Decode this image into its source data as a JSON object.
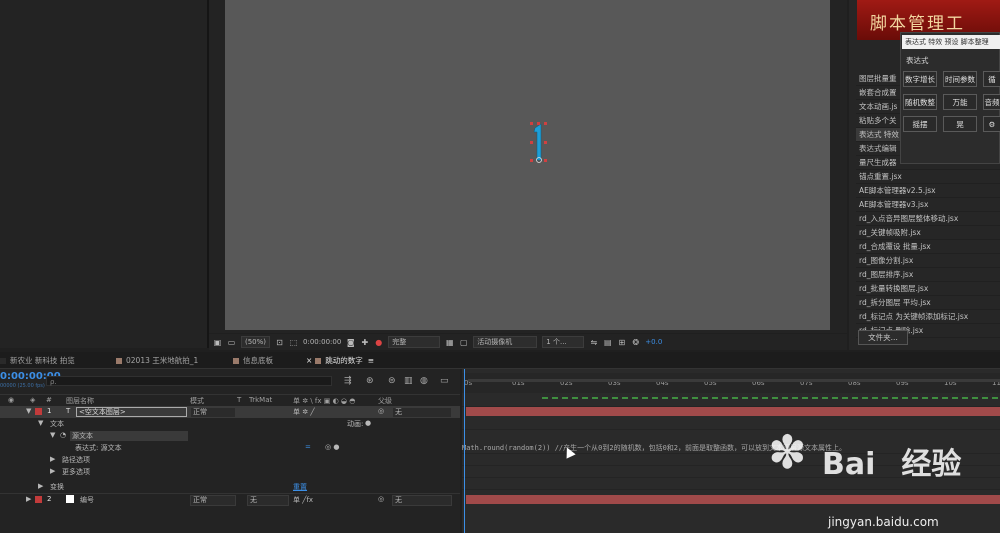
{
  "viewer_toolbar": {
    "zoom": "(50%)",
    "timecode": "0:00:00:00",
    "quality": "完整",
    "camera": "活动摄像机",
    "views": "1 个...",
    "exposure": "+0.0"
  },
  "script_panel": {
    "banner": "脚本管理工",
    "items": [
      "图层批量重",
      "嵌套合成置",
      "文本动画.js",
      "粘贴多个关",
      "表达式 特效",
      "表达式编辑",
      "量尺生成器",
      "锚点重置.jsx",
      "AE脚本管理器v2.5.jsx",
      "AE脚本管理器v3.jsx",
      "rd_入点音异图层整体移动.jsx",
      "rd_关键帧吸附.jsx",
      "rd_合成覆设 批量.jsx",
      "rd_图像分割.jsx",
      "rd_图层排序.jsx",
      "rd_批量转换图层.jsx",
      "rd_拆分图层 平均.jsx",
      "rd_标记点 为关键帧添加标记.jsx",
      "rd_标记点 删除.jsx"
    ],
    "selected_index": 4,
    "files_button": "文件夹..."
  },
  "popup": {
    "tooltip": "表达式 特效 预设 脚本整理",
    "title": "表达式",
    "buttons": [
      [
        "数字增长",
        "时间参数",
        "循"
      ],
      [
        "随机数整",
        "万能",
        "音频"
      ],
      [
        "摇摆",
        "晃",
        ""
      ]
    ]
  },
  "tabs": [
    {
      "label": "新农业 新科技 拍览",
      "active": false
    },
    {
      "label": "02013 王米地航拍_1",
      "active": false
    },
    {
      "label": "信息底板",
      "active": false
    },
    {
      "label": "跳动的数字",
      "active": true
    }
  ],
  "timeline": {
    "timecode": "0:00:00:00",
    "timecode_sub": "00000 (25.00 fps)",
    "search_placeholder": "ρ.",
    "headers": {
      "num": "#",
      "name": "图层名称",
      "mode": "模式",
      "t": "T",
      "trkmat": "TrkMat",
      "switches": "单 ✲ \\ fx ▣ ◐ ◒ ◓",
      "parent": "父级"
    },
    "rows": {
      "layer1": {
        "num": "1",
        "name": "<空文本图层>",
        "mode": "正常",
        "parent": "无"
      },
      "text_group": "文本",
      "animate_label": "动画:",
      "source_text": "源文本",
      "expression_label": "表达式: 源文本",
      "expression_eq": "=",
      "path_options": "路径选项",
      "more_options": "更多选项",
      "transform": "变换",
      "reset": "重置",
      "layer2": {
        "num": "2",
        "name": "编号",
        "mode": "正常",
        "trkmat": "无",
        "parent": "无"
      }
    },
    "ruler_ticks": [
      "0s",
      "01s",
      "02s",
      "03s",
      "04s",
      "05s",
      "06s",
      "07s",
      "08s",
      "09s",
      "10s",
      "11s"
    ],
    "expression_text": "Math.round(random(2)) //产生一个从0到2的随机数，包括0和2，前面是取整函数，可以放到文本图层源文本属性上。"
  },
  "colors": {
    "accent": "#3c8fe6",
    "layer_bar": "#a14a4a",
    "glyph": "#1e9ed6",
    "banner": "#a01a14"
  },
  "watermark": {
    "brand": "Bai",
    "brand2": "经验",
    "url": "jingyan.baidu.com"
  }
}
